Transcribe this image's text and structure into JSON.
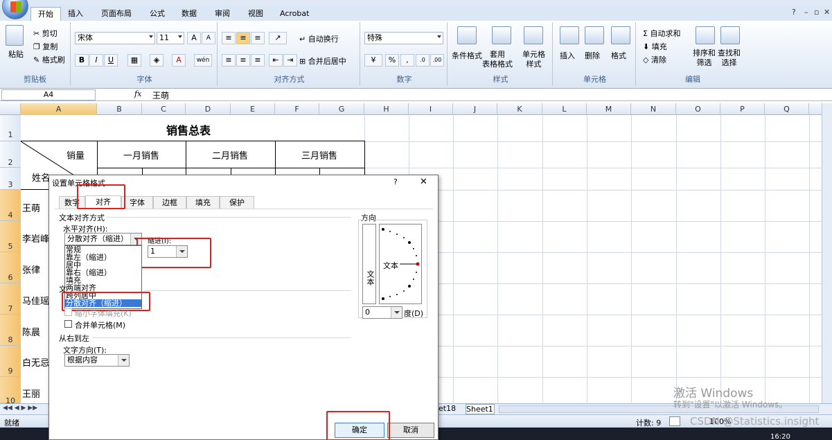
{
  "ribbon": {
    "tabs": [
      "开始",
      "插入",
      "页面布局",
      "公式",
      "数据",
      "审阅",
      "视图",
      "Acrobat"
    ],
    "clipboard": {
      "paste": "粘贴",
      "cut": "剪切",
      "copy": "复制",
      "format_painter": "格式刷",
      "label": "剪贴板"
    },
    "font": {
      "name": "宋体",
      "size": "11",
      "label": "字体",
      "bold": "B",
      "italic": "I",
      "underline": "U",
      "grow": "A",
      "shrink": "A",
      "color_a": "A",
      "phonetic": "wén"
    },
    "alignment": {
      "wrap": "自动换行",
      "merge": "合并后居中",
      "label": "对齐方式"
    },
    "number": {
      "format": "特殊",
      "percent": "%",
      "comma": ",",
      "label": "数字"
    },
    "styles": {
      "conditional": "条件格式",
      "table": "套用\n表格格式",
      "cell_styles": "单元格\n样式",
      "label": "样式"
    },
    "cells": {
      "insert": "插入",
      "delete": "删除",
      "format": "格式",
      "label": "单元格"
    },
    "editing": {
      "autosum": "自动求和",
      "fill": "填充",
      "clear": "清除",
      "sort": "排序和\n筛选",
      "find": "查找和\n选择",
      "label": "编辑"
    }
  },
  "formula_bar": {
    "name_box": "A4",
    "fx": "fx",
    "content": "王萌"
  },
  "columns": [
    "A",
    "B",
    "C",
    "D",
    "E",
    "F",
    "G",
    "H",
    "I",
    "J",
    "K",
    "L",
    "M",
    "N",
    "O",
    "P",
    "Q"
  ],
  "rows": [
    "1",
    "2",
    "3",
    "4",
    "5",
    "6",
    "7",
    "8",
    "9",
    "10"
  ],
  "sheet": {
    "title": "销售总表",
    "header_sales": "销量",
    "header_name": "姓名",
    "months": [
      "一月销售",
      "二月销售",
      "三月销售"
    ],
    "names": [
      "王萌",
      "李岩峰",
      "张律",
      "马佳瑶",
      "陈晨",
      "白无忌",
      "王丽"
    ]
  },
  "sheet_tabs": {
    "partial": "et18",
    "sheet1": "Sheet1"
  },
  "status": {
    "ready": "就绪",
    "count": "计数: 9",
    "zoom": "100%"
  },
  "watermark": {
    "line1": "激活 Windows",
    "line2": "转到\"设置\"以激活 Windows。",
    "csdn": "CSDN @Statistics.insight"
  },
  "taskbar": {
    "time": "16:20"
  },
  "dialog": {
    "title": "设置单元格格式",
    "help": "?",
    "close": "✕",
    "tabs": [
      "数字",
      "对齐",
      "字体",
      "边框",
      "填充",
      "保护"
    ],
    "text_align_section": "文本对齐方式",
    "horizontal_label": "水平对齐(H):",
    "horizontal_value": "分散对齐（缩进）",
    "indent_label": "缩进(I):",
    "indent_value": "1",
    "options": [
      "常规",
      "靠左（缩进）",
      "居中",
      "靠右（缩进）",
      "填充",
      "两端对齐",
      "跨列居中",
      "分散对齐（缩进）"
    ],
    "text_control_partial": "文",
    "shrink_label": "缩小字体填充(K)",
    "merge_label": "合并单元格(M)",
    "rtl_section": "从右到左",
    "direction_label": "文字方向(T):",
    "direction_value": "根据内容",
    "orientation_section": "方向",
    "vertical_text": "文本",
    "horizontal_text": "文本",
    "degrees_value": "0",
    "degrees_label": "度(D)",
    "ok": "确定",
    "cancel": "取消"
  }
}
